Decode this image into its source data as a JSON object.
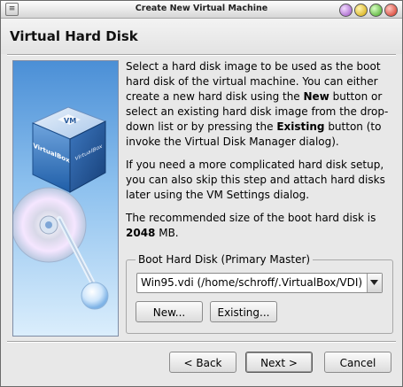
{
  "window": {
    "title": "Create New Virtual Machine"
  },
  "header": {
    "title": "Virtual Hard Disk"
  },
  "description": {
    "p1_a": "Select a hard disk image to be used as the boot hard disk of the virtual machine. You can either create a new hard disk using the ",
    "p1_new": "New",
    "p1_b": " button or select an existing hard disk image from the drop-down list or by pressing the ",
    "p1_existing": "Existing",
    "p1_c": " button (to invoke the Virtual Disk Manager dialog).",
    "p2": "If you need a more complicated hard disk setup, you can also skip this step and attach hard disks later using the VM Settings dialog.",
    "p3_a": "The recommended size of the boot hard disk is ",
    "p3_size": "2048",
    "p3_b": " MB."
  },
  "boot_disk": {
    "group_title": "Boot Hard Disk (Primary Master)",
    "selected_value": "Win95.vdi (/home/schroff/.VirtualBox/VDI)",
    "new_label": "New...",
    "existing_label": "Existing..."
  },
  "navigation": {
    "back_label": "< Back",
    "next_label": "Next >",
    "cancel_label": "Cancel"
  },
  "illustration": {
    "box_label_front": "VirtualBox",
    "box_label_side": "VirtualBox"
  },
  "icons": {
    "title_icon": "menu-icon",
    "dropdown_icon": "chevron-down-icon"
  },
  "colors": {
    "dialog_background": "#e8e8e8",
    "illustration_top": "#4b8fd6",
    "illustration_bottom": "#dbeefc"
  }
}
